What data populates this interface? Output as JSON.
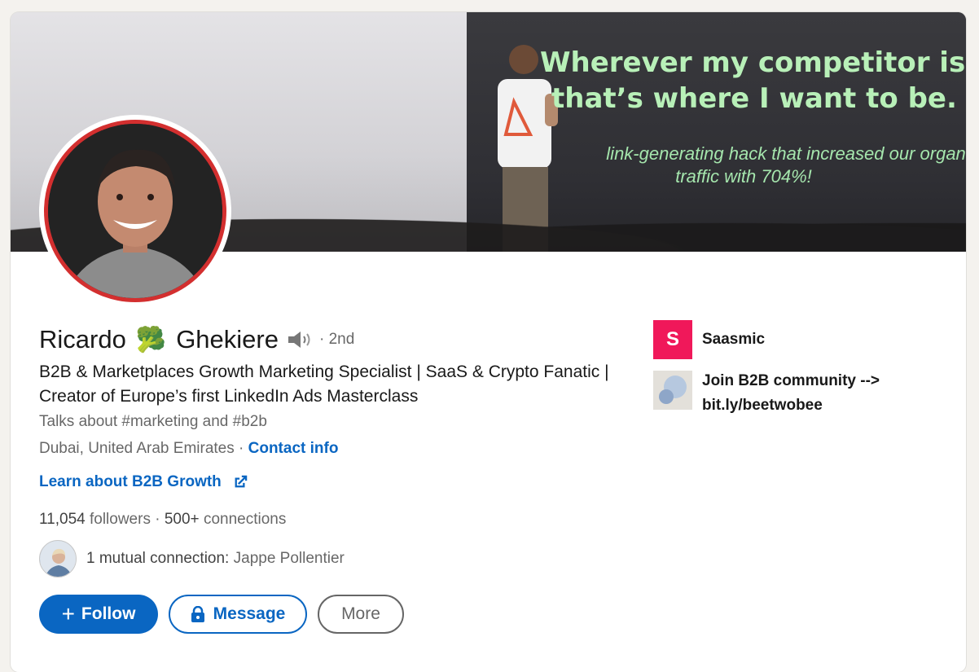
{
  "profile": {
    "first_name": "Ricardo",
    "emoji": "🥦",
    "last_name": "Ghekiere",
    "degree": "· 2nd",
    "headline": "B2B & Marketplaces Growth Marketing Specialist | SaaS & Crypto Fanatic | Creator of Europe’s first LinkedIn Ads Masterclass",
    "talks_about": "Talks about #marketing and #b2b",
    "location": "Dubai, United Arab Emirates",
    "location_separator": " · ",
    "contact_info": "Contact info",
    "website": "Learn about B2B Growth",
    "followers_count": "11,054",
    "followers_label": "followers",
    "connections_sep": " · ",
    "connections_count": "500+",
    "connections_label": "connections",
    "mutual_label": "1 mutual connection:",
    "mutual_name": "Jappe Pollentier"
  },
  "banner": {
    "quote_line1": "Wherever my competitor is,",
    "quote_line2": "that’s where I want to be.",
    "subquote_line1": "link-generating hack that increased our organic",
    "subquote_line2": "traffic with 704%!"
  },
  "actions": {
    "follow": "Follow",
    "message": "Message",
    "more": "More"
  },
  "right_panel": {
    "company_initial": "S",
    "company_name": "Saasmic",
    "community_line1": "Join B2B community -->",
    "community_line2": "bit.ly/beetwobee"
  },
  "colors": {
    "accent": "#0a66c2",
    "avatar_ring": "#d32f2f",
    "company_logo": "#f0185a"
  },
  "icons": [
    "speaker-icon",
    "external-link-icon",
    "plus-icon",
    "lock-icon"
  ]
}
